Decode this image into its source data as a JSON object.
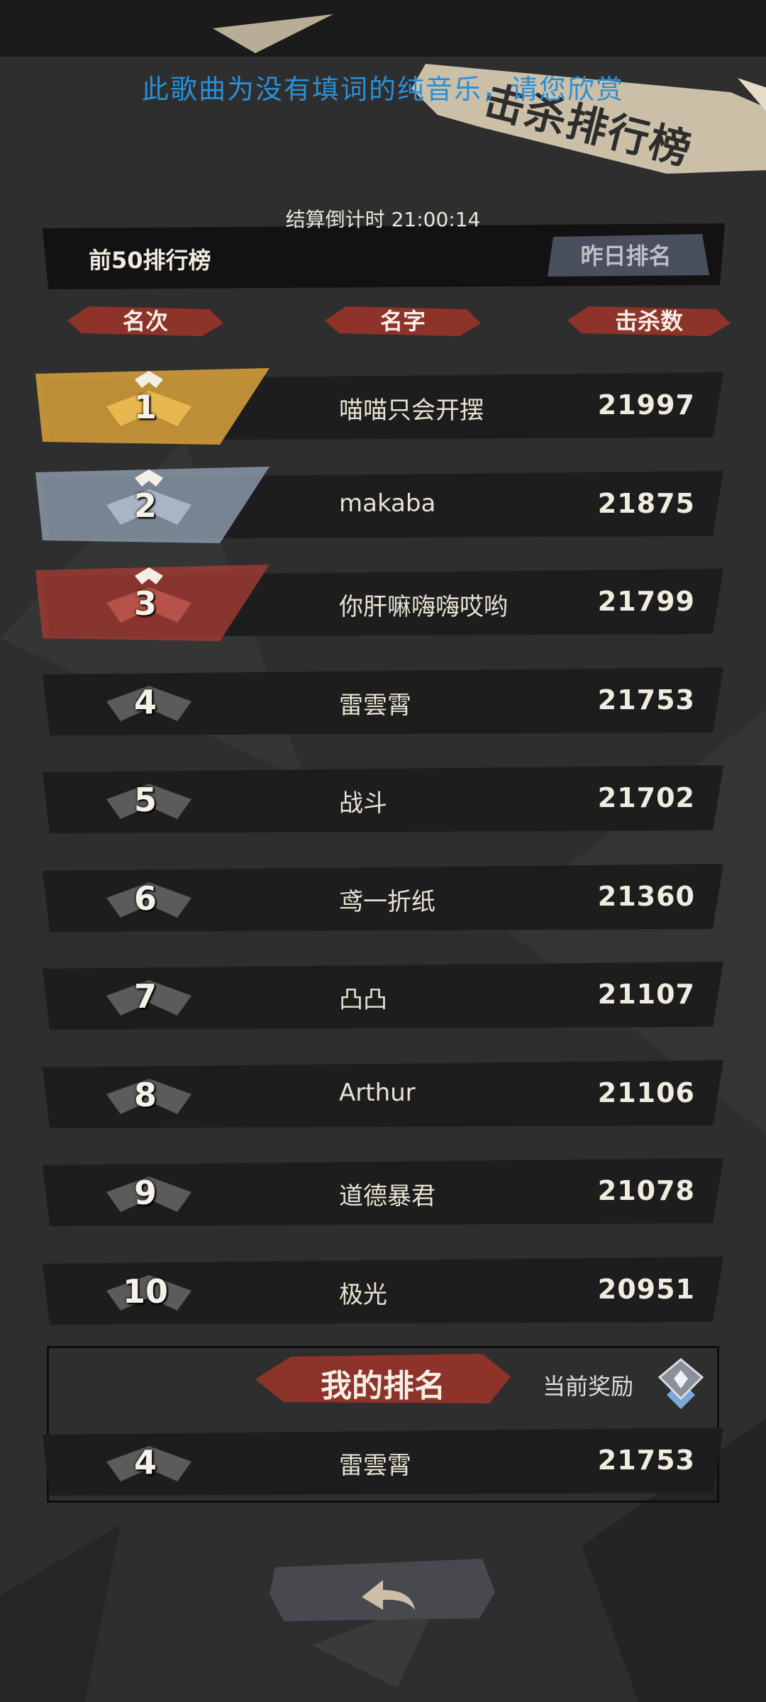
{
  "lyric_notice": "此歌曲为没有填词的纯音乐，请您欣赏",
  "banner_title": "击杀排行榜",
  "countdown": "结算倒计时 21:00:14",
  "tabs": {
    "current": "前50排行榜",
    "yesterday": "昨日排名"
  },
  "columns": {
    "rank": "名次",
    "name": "名字",
    "kills": "击杀数"
  },
  "rows": [
    {
      "rank": "1",
      "name": "喵喵只会开摆",
      "kills": "21997",
      "tier": "gold"
    },
    {
      "rank": "2",
      "name": "makaba",
      "kills": "21875",
      "tier": "silver"
    },
    {
      "rank": "3",
      "name": "你肝嘛嗨嗨哎哟",
      "kills": "21799",
      "tier": "bronze"
    },
    {
      "rank": "4",
      "name": "雷雲霄",
      "kills": "21753",
      "tier": "normal"
    },
    {
      "rank": "5",
      "name": "战斗",
      "kills": "21702",
      "tier": "normal"
    },
    {
      "rank": "6",
      "name": "鸢一折纸",
      "kills": "21360",
      "tier": "normal"
    },
    {
      "rank": "7",
      "name": "凸凸",
      "kills": "21107",
      "tier": "normal"
    },
    {
      "rank": "8",
      "name": "Arthur",
      "kills": "21106",
      "tier": "normal"
    },
    {
      "rank": "9",
      "name": "道德暴君",
      "kills": "21078",
      "tier": "normal"
    },
    {
      "rank": "10",
      "name": "极光",
      "kills": "20951",
      "tier": "normal"
    }
  ],
  "my_rank": {
    "title": "我的排名",
    "reward_label": "当前奖励",
    "rank": "4",
    "name": "雷雲霄",
    "kills": "21753"
  },
  "icons": {
    "back": "back-arrow-icon",
    "reward": "medal-icon",
    "rank_badge": "rank-chevron-icon"
  },
  "colors": {
    "gold": "#d9a23a",
    "silver": "#8a97a8",
    "bronze": "#9c3a33",
    "accent_red": "#a3382e",
    "lyric_blue": "#2a8fd6"
  }
}
